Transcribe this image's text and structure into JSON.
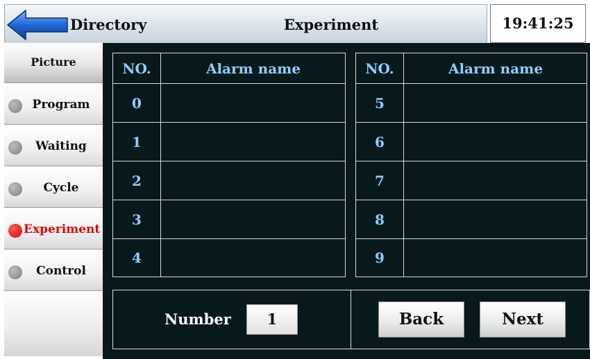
{
  "header": {
    "directory_label": "Directory",
    "title": "Experiment",
    "time": "19:41:25"
  },
  "sidebar": {
    "header_label": "Picture",
    "items": [
      {
        "label": "Program",
        "active": false
      },
      {
        "label": "Waiting",
        "active": false
      },
      {
        "label": "Cycle",
        "active": false
      },
      {
        "label": "Experiment",
        "active": true
      },
      {
        "label": "Control",
        "active": false
      }
    ]
  },
  "tables": {
    "col_no": "NO.",
    "col_name": "Alarm name",
    "left_rows": [
      {
        "no": "0",
        "name": ""
      },
      {
        "no": "1",
        "name": ""
      },
      {
        "no": "2",
        "name": ""
      },
      {
        "no": "3",
        "name": ""
      },
      {
        "no": "4",
        "name": ""
      }
    ],
    "right_rows": [
      {
        "no": "5",
        "name": ""
      },
      {
        "no": "6",
        "name": ""
      },
      {
        "no": "7",
        "name": ""
      },
      {
        "no": "8",
        "name": ""
      },
      {
        "no": "9",
        "name": ""
      }
    ]
  },
  "footer": {
    "number_label": "Number",
    "number_value": "1",
    "back_label": "Back",
    "next_label": "Next"
  },
  "colors": {
    "panel_bg": "#08191c",
    "cell_text": "#8ccfff",
    "active_indicator": "#e00000",
    "back_arrow": "#1a63c8"
  },
  "icons": [
    "back-arrow-icon",
    "status-dot-icon"
  ]
}
